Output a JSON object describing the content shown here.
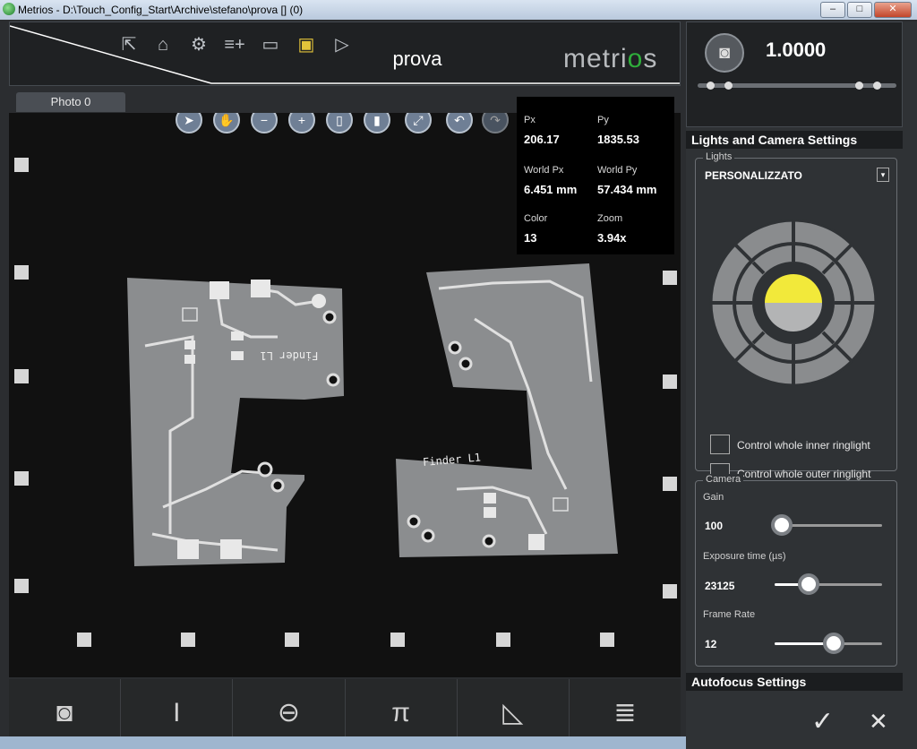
{
  "window": {
    "title": "Metrios - D:\\Touch_Config_Start\\Archive\\stefano\\prova [] (0)",
    "min": "–",
    "max": "□",
    "close": "✕"
  },
  "topbar": {
    "project_title": "prova",
    "logo_prefix": "metri",
    "logo_o": "o",
    "logo_suffix": "s",
    "icons": [
      "export-icon",
      "home-icon",
      "gear-icon",
      "add-list-icon",
      "toolbox-icon",
      "save-icon",
      "play-icon"
    ]
  },
  "viewport": {
    "tab_label": "Photo 0",
    "tools": [
      "pointer-icon",
      "pan-hand-icon",
      "zoom-out-icon",
      "zoom-in-icon",
      "select-rect-icon",
      "ruler-icon",
      "fit-icon",
      "undo-icon",
      "redo-icon"
    ],
    "pcb_left_text": "Finder L1",
    "pcb_right_text": "Finder L1"
  },
  "info": {
    "px_label": "Px",
    "px": "206.17",
    "py_label": "Py",
    "py": "1835.53",
    "wpx_label": "World Px",
    "wpx": "6.451 mm",
    "wpy_label": "World Py",
    "wpy": "57.434 mm",
    "color_label": "Color",
    "color": "13",
    "zoom_label": "Zoom",
    "zoom": "3.94x"
  },
  "bottombar": {
    "tools": [
      "camera-icon",
      "line-measure-icon",
      "circle-measure-icon",
      "pi-icon",
      "angle-icon",
      "thread-icon"
    ]
  },
  "right": {
    "zoom_value": "1.0000",
    "lights_section": "Lights and Camera Settings",
    "lights_group": "Lights",
    "preset": "PERSONALIZZATO",
    "inner_label": "Control whole inner ringlight",
    "outer_label": "Control whole outer ringlight",
    "camera_group": "Camera",
    "gain_label": "Gain",
    "gain": "100",
    "exposure_label": "Exposure time (µs)",
    "exposure": "23125",
    "framerate_label": "Frame Rate",
    "framerate": "12",
    "autofocus_section": "Autofocus Settings",
    "ok": "✓",
    "cancel": "✕",
    "accent": "#f2e93a"
  }
}
